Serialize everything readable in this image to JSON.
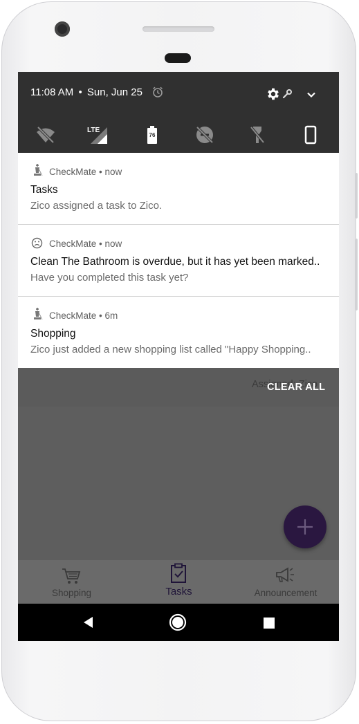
{
  "status_bar": {
    "time": "11:08 AM",
    "separator": "•",
    "date": "Sun, Jun 25",
    "battery_level": "76"
  },
  "quick_settings": {
    "icons": [
      "wifi-off-icon",
      "lte-signal-icon",
      "battery-icon",
      "do-not-disturb-off-icon",
      "flashlight-off-icon",
      "phone-rotation-icon"
    ]
  },
  "notifications": [
    {
      "app": "CheckMate",
      "time": "• now",
      "title": "Tasks",
      "body": "Zico assigned a task to Zico.",
      "icon": "chess-king-icon"
    },
    {
      "app": "CheckMate",
      "time": "• now",
      "title": "Clean The Bathroom is overdue, but it has yet been marked..",
      "body": "Have you completed this task yet?",
      "icon": "sad-face-icon"
    },
    {
      "app": "CheckMate",
      "time": "• 6m",
      "title": "Shopping",
      "body": "Zico just added a new shopping list called \"Happy Shopping..",
      "icon": "chess-king-icon"
    }
  ],
  "shade": {
    "clear_all": "CLEAR ALL"
  },
  "app": {
    "header_partial": "Assigned: Zico",
    "tabs": [
      {
        "label": "Shopping",
        "icon": "shopping-cart-icon",
        "active": false
      },
      {
        "label": "Tasks",
        "icon": "clipboard-check-icon",
        "active": true
      },
      {
        "label": "Announcement",
        "icon": "megaphone-icon",
        "active": false
      }
    ],
    "accent_color": "#2a1740"
  }
}
